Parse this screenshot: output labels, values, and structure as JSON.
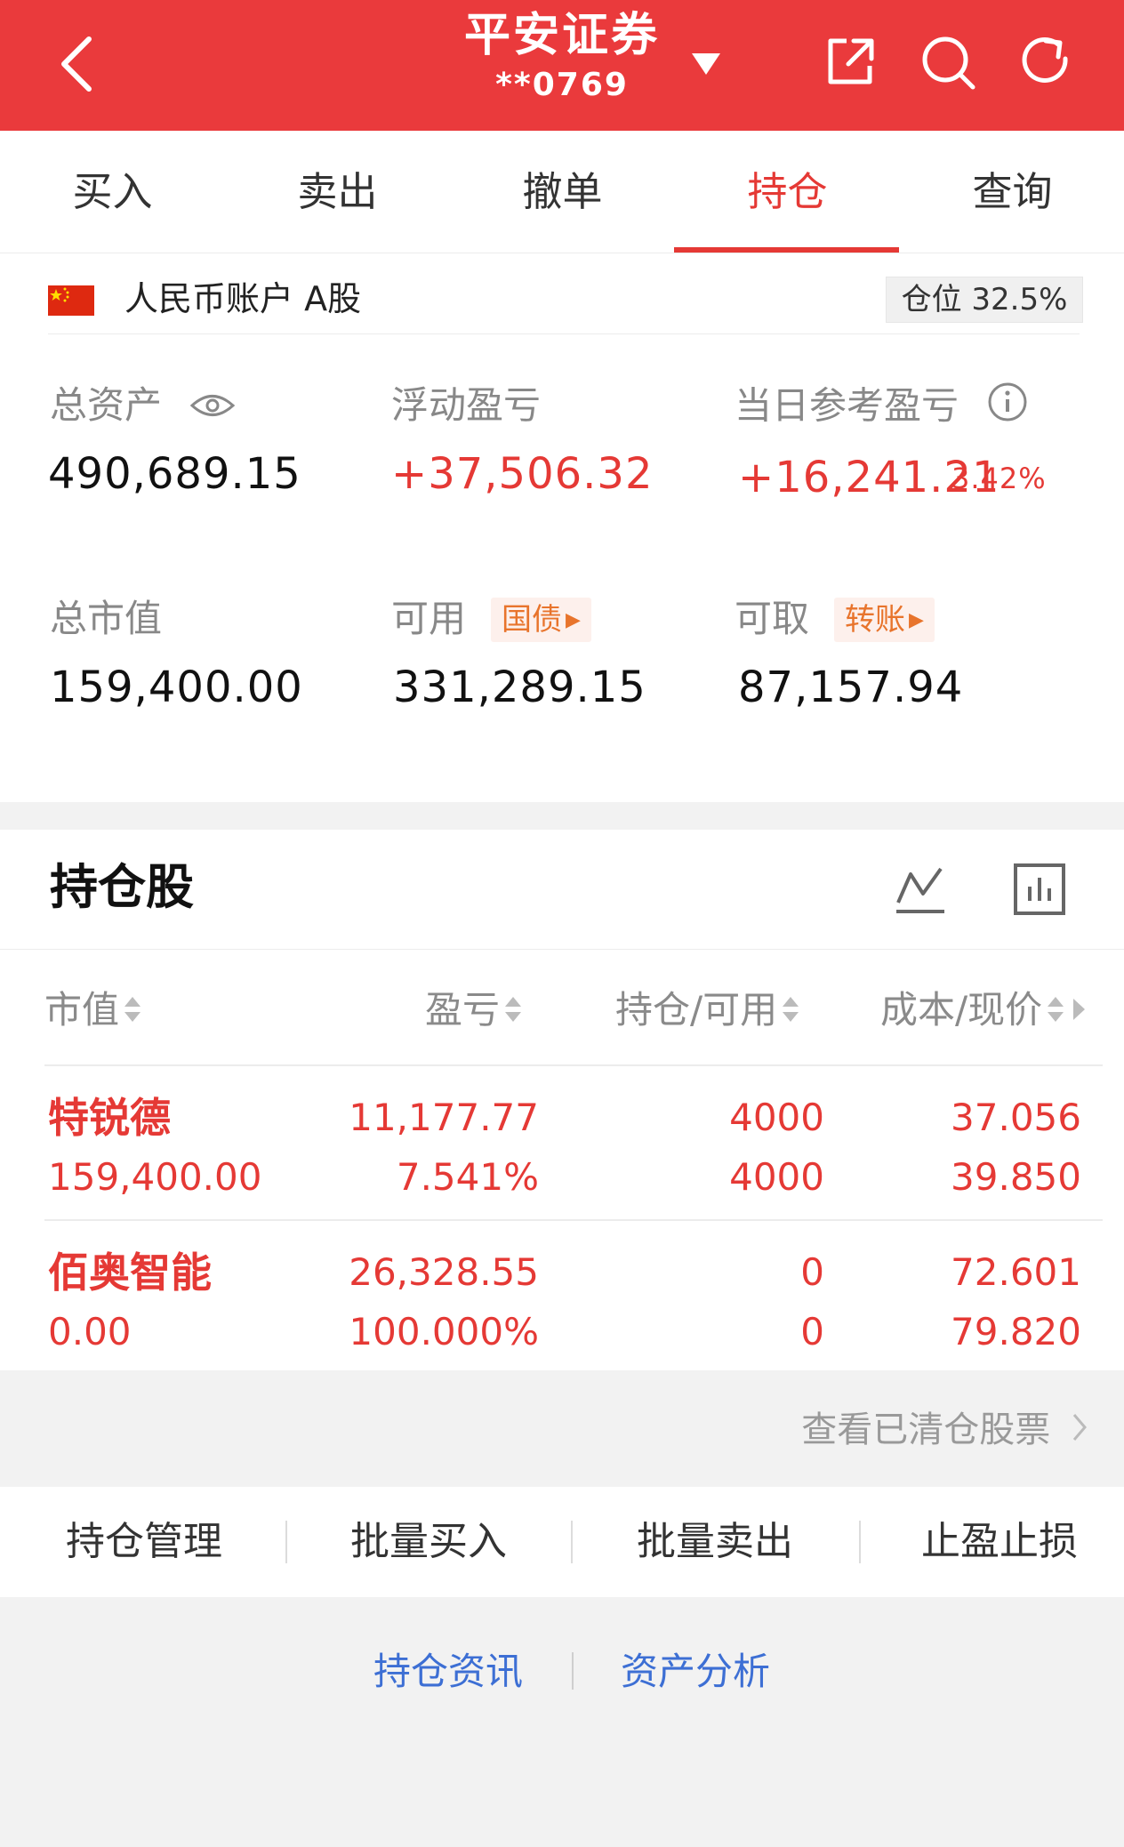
{
  "header": {
    "title": "平安证券",
    "account_masked": "**0769",
    "icons": [
      "back-arrow-icon",
      "dropdown-triangle-icon",
      "share-icon",
      "search-icon",
      "refresh-icon"
    ],
    "bg_color": "#ea3a3c"
  },
  "tabs": [
    {
      "label": "买入",
      "active": false
    },
    {
      "label": "卖出",
      "active": false
    },
    {
      "label": "撤单",
      "active": false
    },
    {
      "label": "持仓",
      "active": true
    },
    {
      "label": "查询",
      "active": false
    }
  ],
  "account": {
    "label": "人民币账户 A股",
    "flag": "china-flag-icon",
    "position_ratio": "仓位 32.5%"
  },
  "summary": {
    "total_assets_label": "总资产",
    "total_assets": "490,689.15",
    "floating_pl_label": "浮动盈亏",
    "floating_pl": "+37,506.32",
    "daily_pl_label": "当日参考盈亏",
    "daily_pl": "+16,241.21",
    "daily_pl_pct": "3.42%",
    "market_value_label": "总市值",
    "market_value": "159,400.00",
    "available_label": "可用",
    "available_tag": "国债",
    "available": "331,289.15",
    "withdrawable_label": "可取",
    "withdrawable_tag": "转账",
    "withdrawable": "87,157.94"
  },
  "holdings": {
    "title": "持仓股",
    "columns": [
      "市值",
      "盈亏",
      "持仓/可用",
      "成本/现价"
    ],
    "rows": [
      {
        "name": "特锐德",
        "market_value": "159,400.00",
        "pl": "11,177.77",
        "pl_pct": "7.541%",
        "position": "4000",
        "available": "4000",
        "cost": "37.056",
        "price": "39.850"
      },
      {
        "name": "佰奥智能",
        "market_value": "0.00",
        "pl": "26,328.55",
        "pl_pct": "100.000%",
        "position": "0",
        "available": "0",
        "cost": "72.601",
        "price": "79.820"
      }
    ]
  },
  "cleared_link": "查看已清仓股票",
  "actions": [
    "持仓管理",
    "批量买入",
    "批量卖出",
    "止盈止损"
  ],
  "links": [
    "持仓资讯",
    "资产分析"
  ],
  "colors": {
    "accent": "#e53935",
    "link": "#3d6fd4",
    "tag": "#e8742c"
  }
}
